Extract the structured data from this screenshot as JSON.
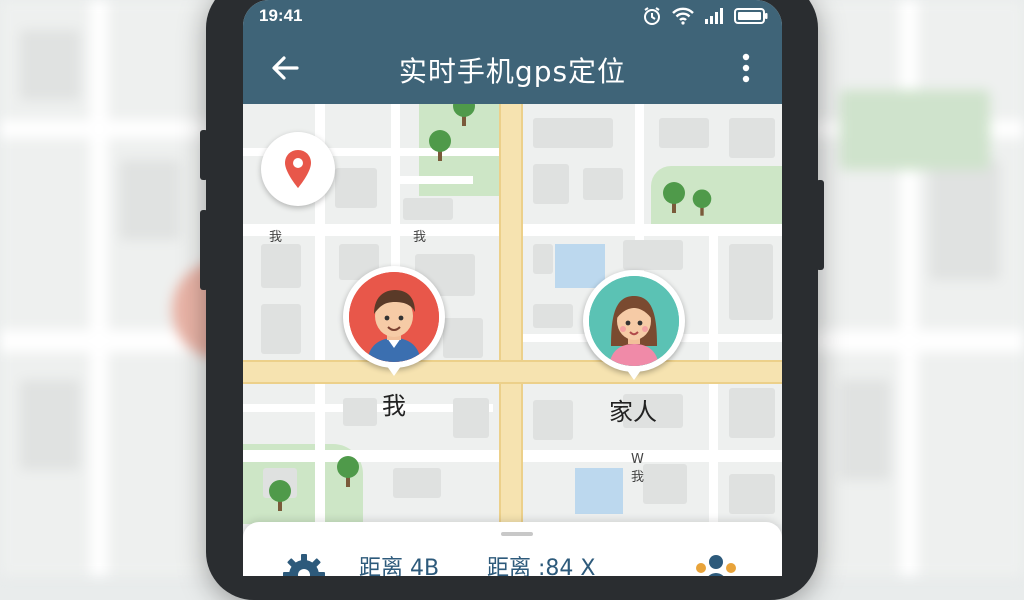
{
  "status_bar": {
    "time": "19:41"
  },
  "header": {
    "title": "实时手机gps定位"
  },
  "map": {
    "labels": [
      "我",
      "我",
      "W",
      "我"
    ],
    "markers": [
      {
        "label": "我"
      },
      {
        "label": "家人"
      }
    ]
  },
  "panel": {
    "distance_a": "距离 4B",
    "distance_b": "距离 :84 X"
  },
  "colors": {
    "header": "#3f6478",
    "accent_red": "#e8574a",
    "accent_teal": "#5bc2b4",
    "road_main": "#f6e3b0",
    "park": "#cde6c6"
  },
  "icons": [
    "back-arrow-icon",
    "more-vert-icon",
    "alarm-icon",
    "wifi-icon",
    "signal-icon",
    "battery-icon",
    "location-pin-icon",
    "gear-icon",
    "people-icon",
    "tree-icon"
  ]
}
